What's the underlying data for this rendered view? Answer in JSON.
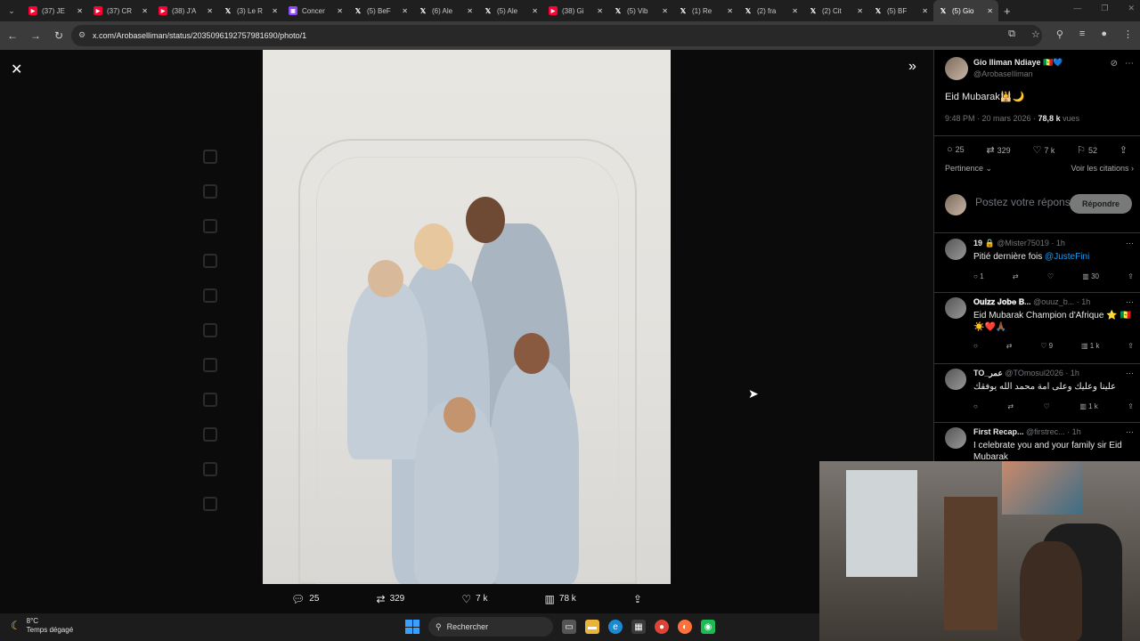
{
  "browser": {
    "tabs": [
      {
        "icon": "youtube",
        "label": "(37) JE"
      },
      {
        "icon": "youtube",
        "label": "(37) CR"
      },
      {
        "icon": "youtube",
        "label": "(38) J'A"
      },
      {
        "icon": "x",
        "label": "(3) Le R"
      },
      {
        "icon": "twitch",
        "label": "Concer"
      },
      {
        "icon": "x",
        "label": "(5) BeF"
      },
      {
        "icon": "x",
        "label": "(6) Ale"
      },
      {
        "icon": "x",
        "label": "(5) Ale"
      },
      {
        "icon": "youtube",
        "label": "(38) Gi"
      },
      {
        "icon": "x",
        "label": "(5) Vib"
      },
      {
        "icon": "x",
        "label": "(1) Re"
      },
      {
        "icon": "x",
        "label": "(2) fra"
      },
      {
        "icon": "x",
        "label": "(2) Cit"
      },
      {
        "icon": "x",
        "label": "(5) BF"
      },
      {
        "icon": "x",
        "label": "(5) Gio",
        "active": true
      }
    ],
    "url": "x.com/Arobaselliman/status/2035096192757981690/photo/1"
  },
  "viewer": {
    "stats": {
      "replies": "25",
      "retweets": "329",
      "likes": "7 k",
      "views": "78 k"
    }
  },
  "tweet": {
    "author_name": "Gio Iliman Ndiaye 🇸🇳💙",
    "author_handle": "@ArobaseIliman",
    "text": "Eid Mubarak🕌🌙",
    "time": "9:48 PM · 20 mars 2026 · ",
    "views_count": "78,8 k",
    "views_label": " vues",
    "actions": {
      "replies": "25",
      "retweets": "329",
      "likes": "7 k",
      "bookmarks": "52"
    },
    "sort_label": "Pertinence",
    "quotes_link": "Voir les citations",
    "reply_placeholder": "Postez votre réponse",
    "reply_button": "Répondre"
  },
  "replies": [
    {
      "name": "19 🔒",
      "handle": "@Mister75019 · 1h",
      "text": "Pitié dernière fois ",
      "mention": "@JusteFini",
      "replies": "1",
      "retweets": "",
      "likes": "",
      "views": "30"
    },
    {
      "name": "𝐎𝐮𝐢𝐳𝐳 𝐉𝐨𝐛𝐞 𝐁...",
      "handle": "@ouuz_b... · 1h",
      "text": "Eid Mubarak Champion d'Afrique ⭐ 🇸🇳☀️❤️🙏🏾",
      "mention": "",
      "replies": "",
      "retweets": "",
      "likes": "9",
      "views": "1 k"
    },
    {
      "name": "TO_عمر",
      "handle": "@TOmosul2026 · 1h",
      "text": "علينا وعليك وعلى امة محمد الله يوفقك",
      "mention": "",
      "replies": "",
      "retweets": "",
      "likes": "",
      "views": "1 k"
    },
    {
      "name": "First Recap...",
      "handle": "@firstrec... · 1h",
      "text": "I celebrate you and your family sir Eid Mubarak",
      "mention": "",
      "replies": "",
      "retweets": "",
      "likes": "",
      "views": ""
    }
  ],
  "taskbar": {
    "temperature": "8°C",
    "weather": "Temps dégagé",
    "search_label": "Rechercher"
  }
}
